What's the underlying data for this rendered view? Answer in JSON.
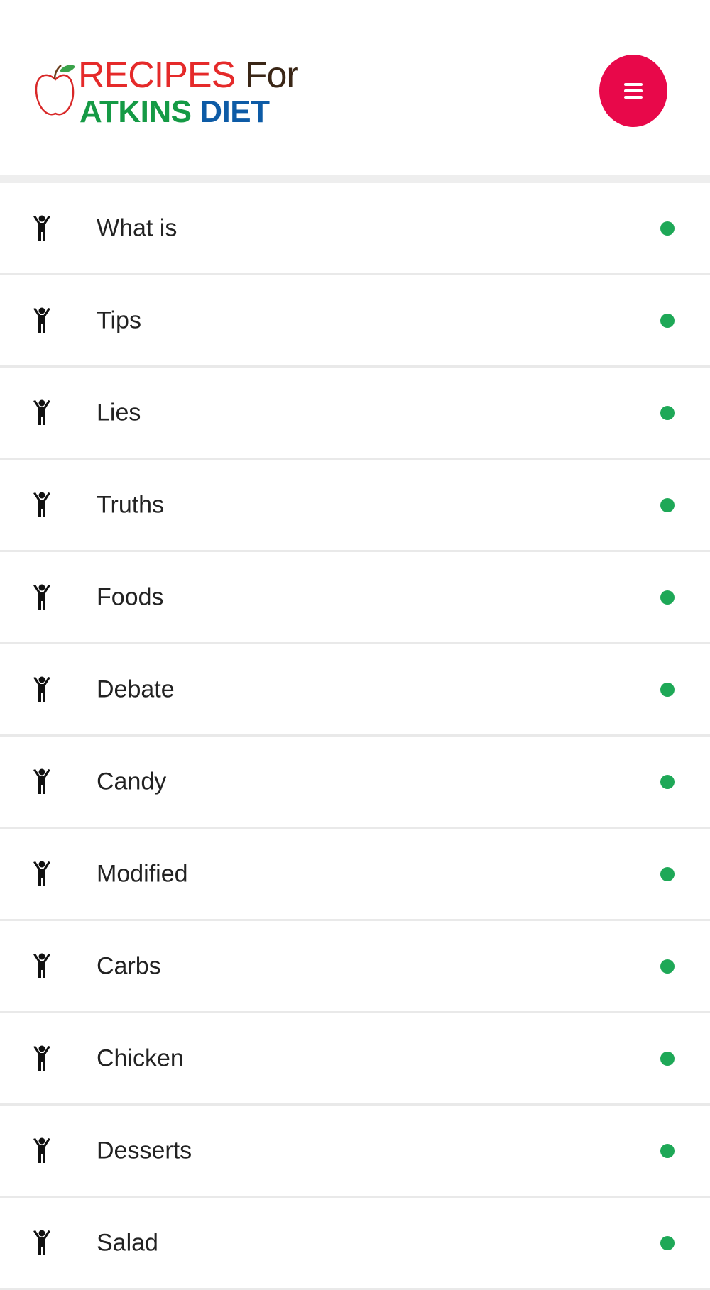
{
  "logo": {
    "word1": "RECIPES",
    "word2": "For",
    "word3": "ATKINS",
    "word4": "DIET",
    "icon": "apple-icon"
  },
  "header": {
    "menu_icon": "hamburger-menu-icon"
  },
  "colors": {
    "accent": "#e8084a",
    "dot": "#1ea857",
    "logo_red": "#e52a2a",
    "logo_green": "#159a45",
    "logo_blue": "#0d5ba6"
  },
  "nav": {
    "item_icon": "person-icon",
    "items": [
      {
        "label": "What is"
      },
      {
        "label": "Tips"
      },
      {
        "label": "Lies"
      },
      {
        "label": "Truths"
      },
      {
        "label": "Foods"
      },
      {
        "label": "Debate"
      },
      {
        "label": "Candy"
      },
      {
        "label": "Modified"
      },
      {
        "label": "Carbs"
      },
      {
        "label": "Chicken"
      },
      {
        "label": "Desserts"
      },
      {
        "label": "Salad"
      }
    ]
  }
}
